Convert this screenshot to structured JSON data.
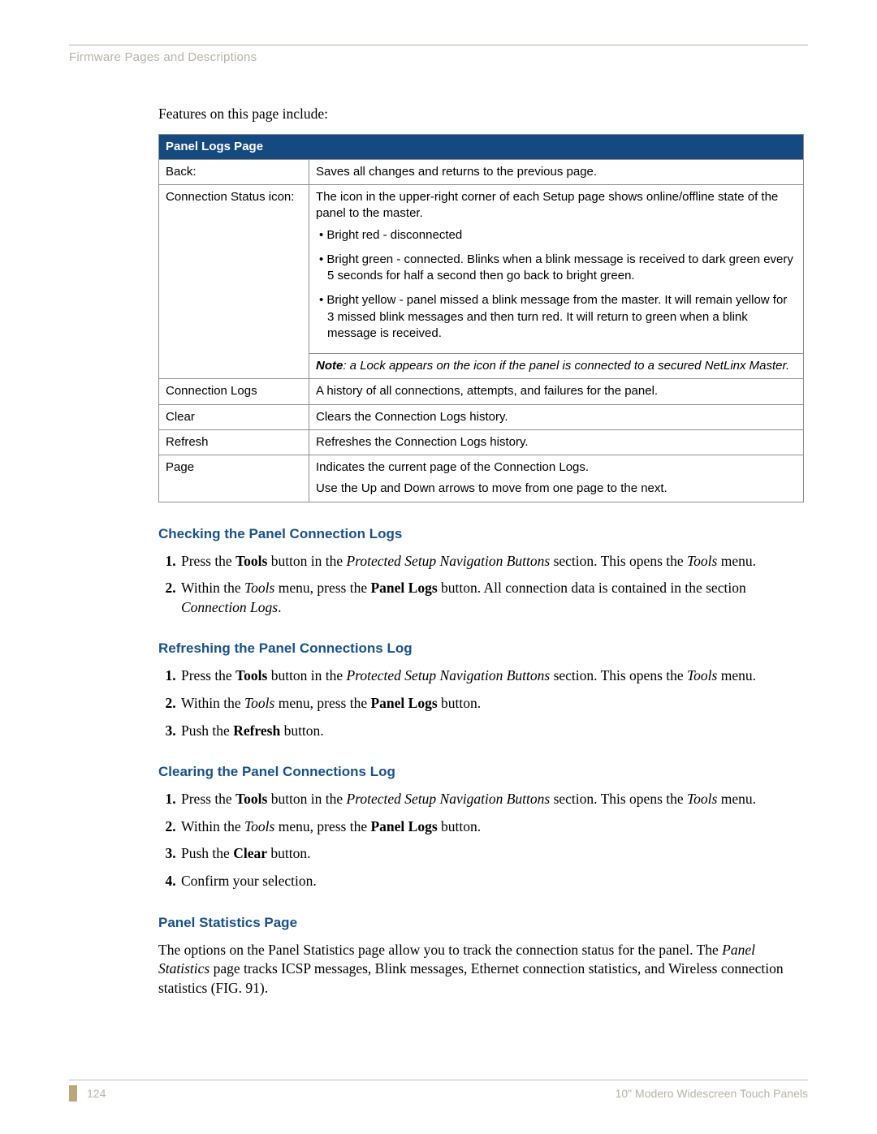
{
  "header": {
    "running": "Firmware Pages and Descriptions"
  },
  "intro": "Features on this page include:",
  "table": {
    "title": "Panel Logs Page",
    "rows": {
      "back": {
        "label": "Back:",
        "desc": "Saves all changes and returns to the previous page."
      },
      "conn_status": {
        "label": "Connection Status icon:",
        "desc_intro": "The icon in the upper-right corner of each Setup page shows online/offline state of the panel to the master.",
        "bullets": [
          "Bright red - disconnected",
          "Bright green - connected. Blinks when a blink message is received to dark green every 5 seconds for half a second then go back to bright green.",
          "Bright yellow - panel missed a blink message from the master. It will remain yellow for 3 missed blink messages and then turn red. It will return to green when a blink message is received."
        ],
        "note_label": "Note",
        "note_text": ": a Lock appears on the icon if the panel is connected to a secured NetLinx Master."
      },
      "conn_logs": {
        "label": "Connection Logs",
        "desc": "A history of all connections, attempts, and failures for the panel."
      },
      "clear": {
        "label": "Clear",
        "desc": "Clears the Connection Logs history."
      },
      "refresh": {
        "label": "Refresh",
        "desc": "Refreshes the Connection Logs history."
      },
      "page": {
        "label": "Page",
        "desc1": "Indicates the current page of the Connection Logs.",
        "desc2": "Use the Up and Down arrows to move from one page to the next."
      }
    }
  },
  "sections": {
    "check": {
      "title": "Checking the Panel Connection Logs",
      "step1_a": "Press the ",
      "step1_b": "Tools",
      "step1_c": " button in the ",
      "step1_d": "Protected Setup Navigation Buttons",
      "step1_e": " section. This opens the ",
      "step1_f": "Tools",
      "step1_g": " menu.",
      "step2_a": "Within the ",
      "step2_b": "Tools",
      "step2_c": " menu, press the ",
      "step2_d": "Panel Logs",
      "step2_e": " button. All connection data is contained in the section ",
      "step2_f": "Connection Logs",
      "step2_g": "."
    },
    "refresh": {
      "title": "Refreshing the Panel Connections Log",
      "step1_a": "Press the ",
      "step1_b": "Tools",
      "step1_c": " button in the ",
      "step1_d": "Protected Setup Navigation Buttons",
      "step1_e": " section. This opens the ",
      "step1_f": "Tools",
      "step1_g": " menu.",
      "step2_a": "Within the ",
      "step2_b": "Tools",
      "step2_c": " menu, press the ",
      "step2_d": "Panel Logs",
      "step2_e": " button.",
      "step3_a": "Push the ",
      "step3_b": "Refresh",
      "step3_c": " button."
    },
    "clear": {
      "title": "Clearing the Panel Connections Log",
      "step1_a": "Press the ",
      "step1_b": "Tools",
      "step1_c": " button in the ",
      "step1_d": "Protected Setup Navigation Buttons",
      "step1_e": " section. This opens the ",
      "step1_f": "Tools",
      "step1_g": " menu.",
      "step2_a": "Within the ",
      "step2_b": "Tools",
      "step2_c": " menu, press the ",
      "step2_d": "Panel Logs",
      "step2_e": " button.",
      "step3_a": "Push the ",
      "step3_b": "Clear",
      "step3_c": " button.",
      "step4": "Confirm your selection."
    },
    "stats": {
      "title": "Panel Statistics Page",
      "p_a": "The options on the Panel Statistics page allow you to track the connection status for the panel. The ",
      "p_b": "Panel Statistics",
      "p_c": " page tracks ICSP messages, Blink messages, Ethernet connection statistics, and Wireless connection statistics (FIG. 91)."
    }
  },
  "footer": {
    "page": "124",
    "title": "10\" Modero Widescreen Touch Panels"
  }
}
